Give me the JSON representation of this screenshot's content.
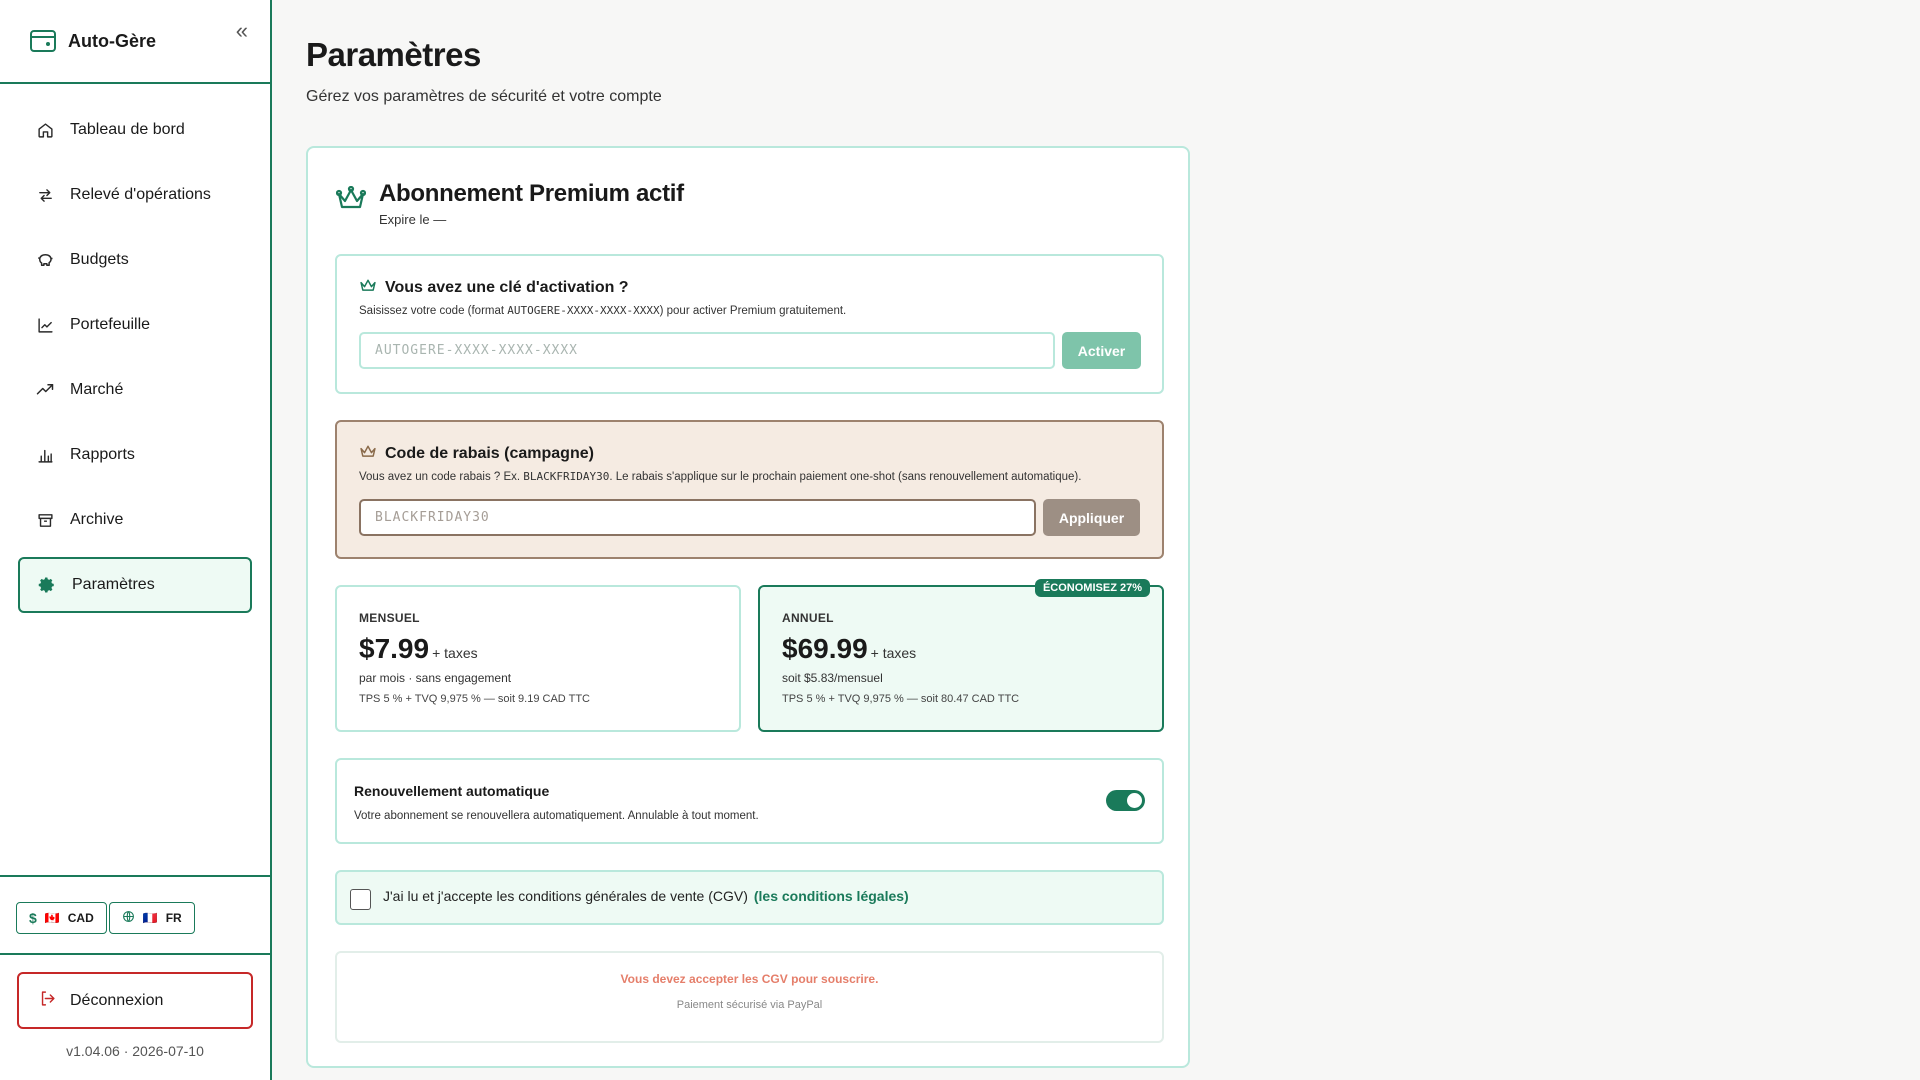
{
  "app": {
    "name": "Auto-Gère",
    "collapse_glyph": "«"
  },
  "sidebar": {
    "items": [
      {
        "label": "Tableau de bord",
        "icon": "home-icon"
      },
      {
        "label": "Relevé d'opérations",
        "icon": "arrows-swap-icon"
      },
      {
        "label": "Budgets",
        "icon": "piggy-bank-icon"
      },
      {
        "label": "Portefeuille",
        "icon": "line-chart-icon"
      },
      {
        "label": "Marché",
        "icon": "trending-up-icon"
      },
      {
        "label": "Rapports",
        "icon": "bar-chart-icon"
      },
      {
        "label": "Archive",
        "icon": "archive-icon"
      },
      {
        "label": "Paramètres",
        "icon": "gear-icon",
        "active": true
      }
    ],
    "currency": {
      "symbol": "$",
      "flag": "🇨🇦",
      "label": "CAD"
    },
    "language": {
      "flag": "🇫🇷",
      "label": "FR"
    },
    "logout": "Déconnexion",
    "version": "v1.04.06 · 2026-07-10"
  },
  "page": {
    "title": "Paramètres",
    "subtitle": "Gérez vos paramètres de sécurité et votre compte"
  },
  "premium": {
    "title": "Abonnement Premium actif",
    "expire": "Expire le —"
  },
  "activation": {
    "title": "Vous avez une clé d'activation ?",
    "desc_before": "Saisissez votre code (format ",
    "desc_code": "AUTOGERE-XXXX-XXXX-XXXX",
    "desc_after": ") pour activer Premium gratuitement.",
    "placeholder": "AUTOGERE-XXXX-XXXX-XXXX",
    "button": "Activer"
  },
  "promo": {
    "title": "Code de rabais (campagne)",
    "desc_before": "Vous avez un code rabais ? Ex. ",
    "desc_code": "BLACKFRIDAY30",
    "desc_after": ". Le rabais s'applique sur le prochain paiement one-shot (sans renouvellement automatique).",
    "placeholder": "BLACKFRIDAY30",
    "button": "Appliquer"
  },
  "plans": {
    "monthly": {
      "label": "MENSUEL",
      "price": "$7.99",
      "taxes": "+ taxes",
      "note": "par mois · sans engagement",
      "tax_note": "TPS 5 % + TVQ 9,975 % — soit 9.19 CAD TTC"
    },
    "annual": {
      "label": "ANNUEL",
      "badge": "ÉCONOMISEZ 27%",
      "price": "$69.99",
      "taxes": "+ taxes",
      "note": "soit $5.83/mensuel",
      "tax_note": "TPS 5 % + TVQ 9,975 % — soit 80.47 CAD TTC",
      "selected": true
    }
  },
  "renewal": {
    "title": "Renouvellement automatique",
    "desc": "Votre abonnement se renouvellera automatiquement. Annulable à tout moment.",
    "enabled": true
  },
  "cgv": {
    "text": "J'ai lu et j'accepte les conditions générales de vente (CGV)",
    "link": "(les conditions légales)",
    "checked": false
  },
  "payment": {
    "warning": "Vous devez accepter les CGV pour souscrire.",
    "secure": "Paiement sécurisé via PayPal"
  },
  "colors": {
    "accent": "#1a7a5a",
    "accent_light": "#b9e8dc",
    "danger": "#c62828",
    "promo_bg": "#f5ebe2",
    "warning_text": "#e57e6a"
  }
}
